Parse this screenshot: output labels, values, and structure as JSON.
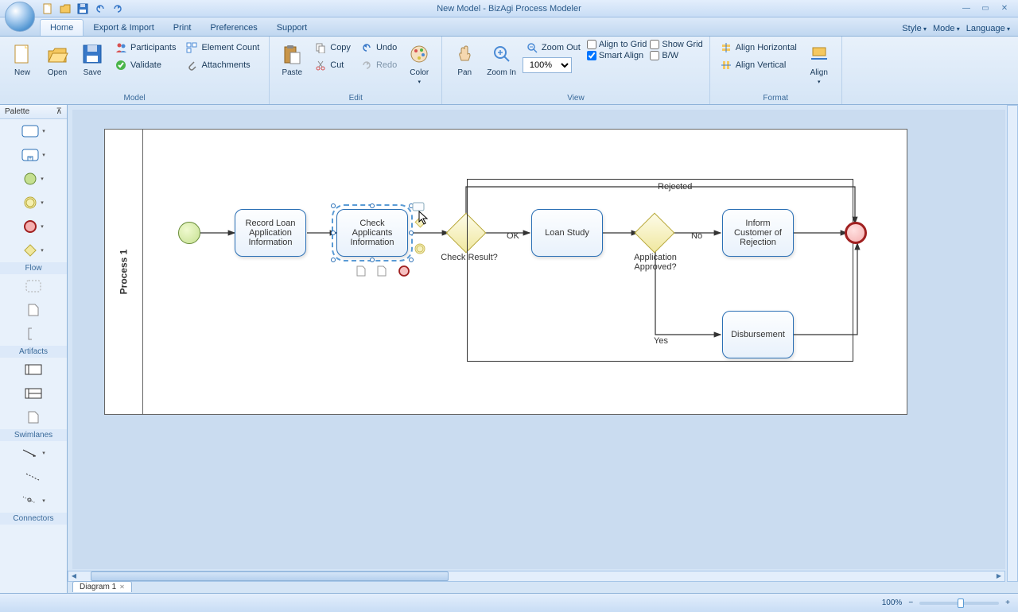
{
  "title": "New Model - BizAgi Process Modeler",
  "tabs": [
    "Home",
    "Export & Import",
    "Print",
    "Preferences",
    "Support"
  ],
  "right_menu": [
    "Style",
    "Mode",
    "Language"
  ],
  "ribbon": {
    "model": {
      "label": "Model",
      "new": "New",
      "open": "Open",
      "save": "Save",
      "participants": "Participants",
      "element_count": "Element Count",
      "validate": "Validate",
      "attachments": "Attachments"
    },
    "edit": {
      "label": "Edit",
      "paste": "Paste",
      "copy": "Copy",
      "cut": "Cut",
      "undo": "Undo",
      "redo": "Redo",
      "color": "Color"
    },
    "view": {
      "label": "View",
      "pan": "Pan",
      "zoom_in": "Zoom In",
      "zoom_out": "Zoom Out",
      "zoom_value": "100%",
      "align_to_grid": "Align to Grid",
      "show_grid": "Show Grid",
      "smart_align": "Smart Align",
      "bw": "B/W"
    },
    "format": {
      "label": "Format",
      "align_h": "Align Horizontal",
      "align_v": "Align Vertical",
      "align": "Align"
    }
  },
  "palette": {
    "title": "Palette",
    "sections": {
      "flow": "Flow",
      "artifacts": "Artifacts",
      "swimlanes": "Swimlanes",
      "connectors": "Connectors"
    }
  },
  "diagram": {
    "lane": "Process 1",
    "tasks": {
      "record": "Record Loan Application Information",
      "check_app": "Check Applicants Information",
      "loan_study": "Loan Study",
      "inform_rej": "Inform Customer of Rejection",
      "disb": "Disbursement"
    },
    "gateways": {
      "check_result": "Check Result?",
      "approved": "Application Approved?"
    },
    "flows": {
      "ok": "OK",
      "no": "No",
      "yes": "Yes",
      "rejected": "Rejected"
    },
    "sheet_tab": "Diagram 1"
  },
  "status": {
    "zoom": "100%"
  }
}
